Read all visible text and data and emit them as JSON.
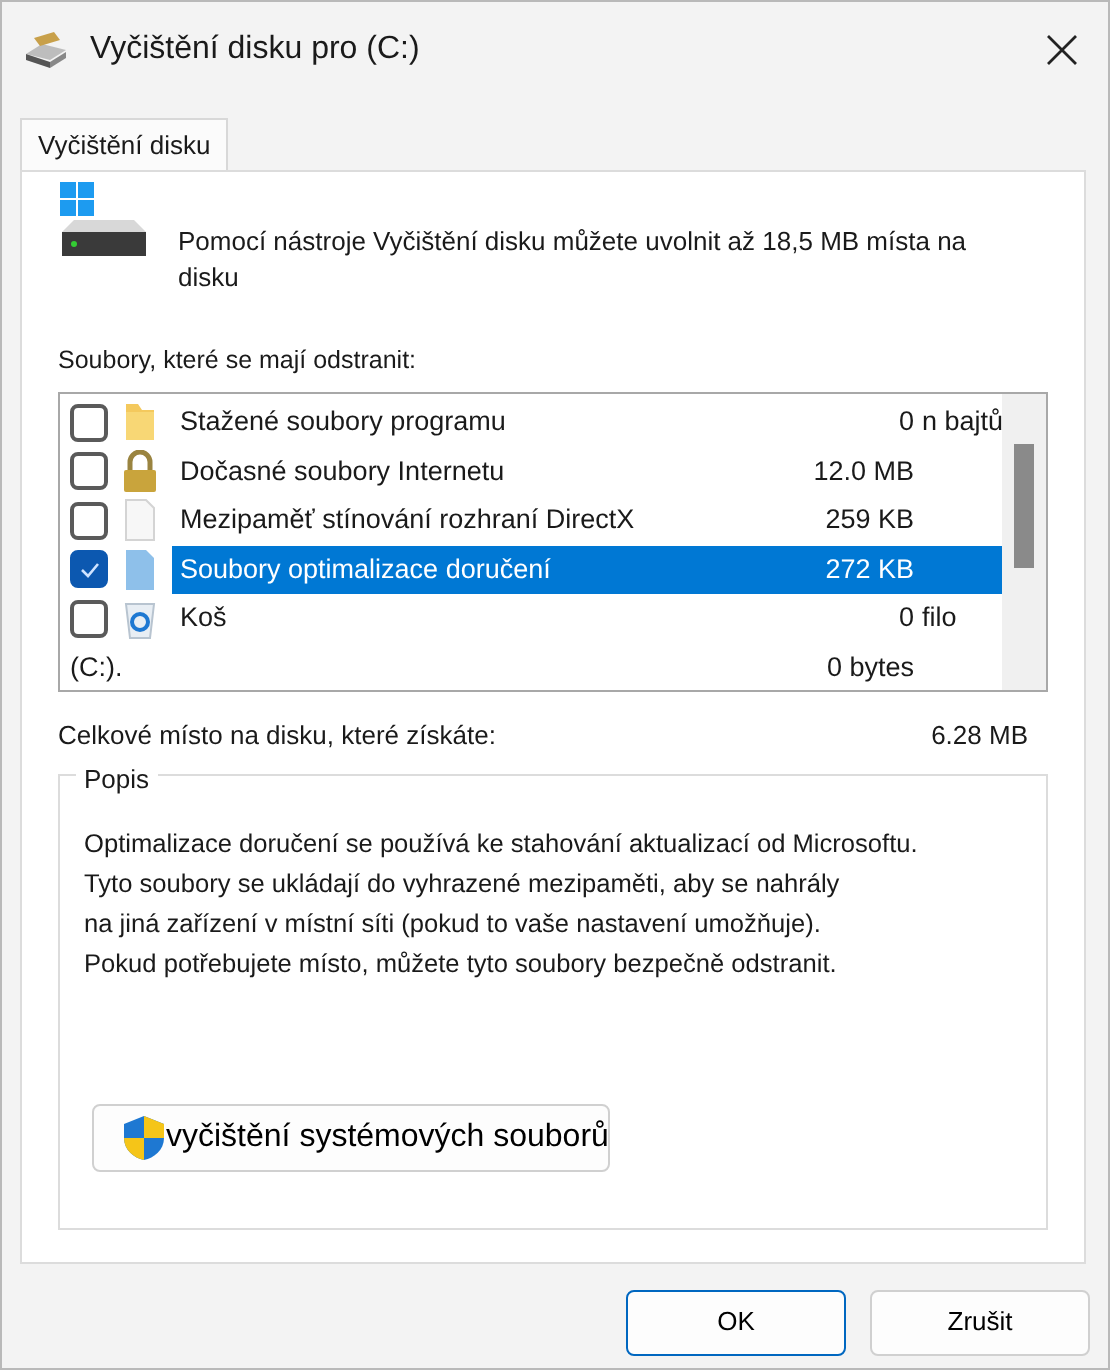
{
  "window": {
    "title": "Vyčištění disku pro (C:)"
  },
  "tabs": [
    {
      "label": "Vyčištění disku",
      "selected": true
    }
  ],
  "intro": "Pomocí nástroje Vyčištění disku můžete uvolnit až 18,5 MB místa na disku",
  "files_label": "Soubory, které se mají odstranit:",
  "files": [
    {
      "kind": "folder",
      "name": "Stažené soubory programu",
      "size": "0",
      "suffix": "n bajtů",
      "checked": false,
      "selected": false
    },
    {
      "kind": "lock",
      "name": "Dočasné soubory Internetu",
      "size": "12.0 MB",
      "checked": false,
      "selected": false
    },
    {
      "kind": "file",
      "name": "Mezipaměť stínování rozhraní DirectX",
      "size": "259 KB",
      "checked": false,
      "selected": false
    },
    {
      "kind": "file-blue",
      "name": "Soubory optimalizace doručení",
      "size": "272 KB",
      "checked": true,
      "selected": true
    },
    {
      "kind": "recycle",
      "name": "Koš",
      "size": "0",
      "suffix": "filo",
      "checked": false,
      "selected": false
    },
    {
      "kind": "text",
      "name": "(C:).",
      "size": "0 bytes"
    }
  ],
  "total_label": "Celkové místo na disku, které získáte:",
  "total_value": "6.28 MB",
  "description": {
    "title": "Popis",
    "lines": [
      "Optimalizace doručení se používá ke stahování aktualizací od Microsoftu.",
      "Tyto soubory se ukládají do vyhrazené mezipaměti, aby se nahrály",
      "na jiná zařízení v místní síti (pokud to vaše nastavení umožňuje).",
      "Pokud potřebujete místo, můžete tyto soubory bezpečně odstranit."
    ]
  },
  "system_button": "vyčištění systémových souborů",
  "buttons": [
    {
      "label": "OK",
      "default": true
    },
    {
      "label": "Zrušit",
      "default": false
    }
  ]
}
